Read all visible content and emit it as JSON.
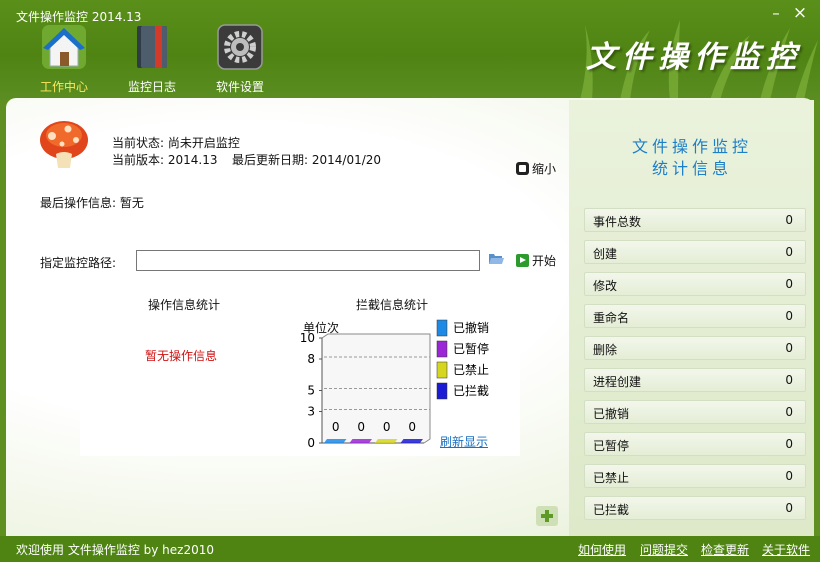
{
  "window": {
    "title": "文件操作监控 2014.13",
    "min_symbol": "–",
    "close_symbol": "×"
  },
  "nav": [
    {
      "label": "工作中心",
      "icon": "home-icon",
      "active": true
    },
    {
      "label": "监控日志",
      "icon": "log-book-icon",
      "active": false
    },
    {
      "label": "软件设置",
      "icon": "gear-icon",
      "active": false
    }
  ],
  "brand": "文件操作监控",
  "info": {
    "status_label": "当前状态:",
    "status_value": "尚未开启监控",
    "version_label": "当前版本:",
    "version_value": "2014.13",
    "update_label": "最后更新日期:",
    "update_value": "2014/01/20",
    "last_op_label": "最后操作信息:",
    "last_op_value": "暂无",
    "shrink_label": "缩小"
  },
  "path": {
    "label": "指定监控路径:",
    "value": "",
    "start_label": "开始"
  },
  "op_stats": {
    "title": "操作信息统计",
    "empty": "暂无操作信息"
  },
  "chart_data": {
    "type": "bar",
    "title": "拦截信息统计",
    "ylabel": "单位次",
    "ylim": [
      0,
      10
    ],
    "yticks": [
      0,
      3,
      5,
      8,
      10
    ],
    "series": [
      {
        "name": "已撤销",
        "values": [
          0
        ],
        "color": "#1e8ae6"
      },
      {
        "name": "已暂停",
        "values": [
          0
        ],
        "color": "#9b26d6"
      },
      {
        "name": "已禁止",
        "values": [
          0
        ],
        "color": "#d6d61e"
      },
      {
        "name": "已拦截",
        "values": [
          0
        ],
        "color": "#1b1bd6"
      }
    ],
    "data_labels": [
      "0",
      "0",
      "0",
      "0"
    ],
    "refresh_label": "刷新显示"
  },
  "stats": {
    "title_line1": "文件操作监控",
    "title_line2": "统计信息",
    "rows": [
      {
        "name": "事件总数",
        "value": "0"
      },
      {
        "name": "创建",
        "value": "0"
      },
      {
        "name": "修改",
        "value": "0"
      },
      {
        "name": "重命名",
        "value": "0"
      },
      {
        "name": "删除",
        "value": "0"
      },
      {
        "name": "进程创建",
        "value": "0"
      },
      {
        "name": "已撤销",
        "value": "0"
      },
      {
        "name": "已暂停",
        "value": "0"
      },
      {
        "name": "已禁止",
        "value": "0"
      },
      {
        "name": "已拦截",
        "value": "0"
      }
    ]
  },
  "footer": {
    "status": "欢迎使用 文件操作监控 by hez2010",
    "links": [
      "如何使用",
      "问题提交",
      "检查更新",
      "关于软件"
    ]
  },
  "colors": {
    "frame": "#4f8413",
    "accent_title": "#1c7fc8",
    "active_nav": "#ffe85c",
    "warning": "#d01010"
  }
}
